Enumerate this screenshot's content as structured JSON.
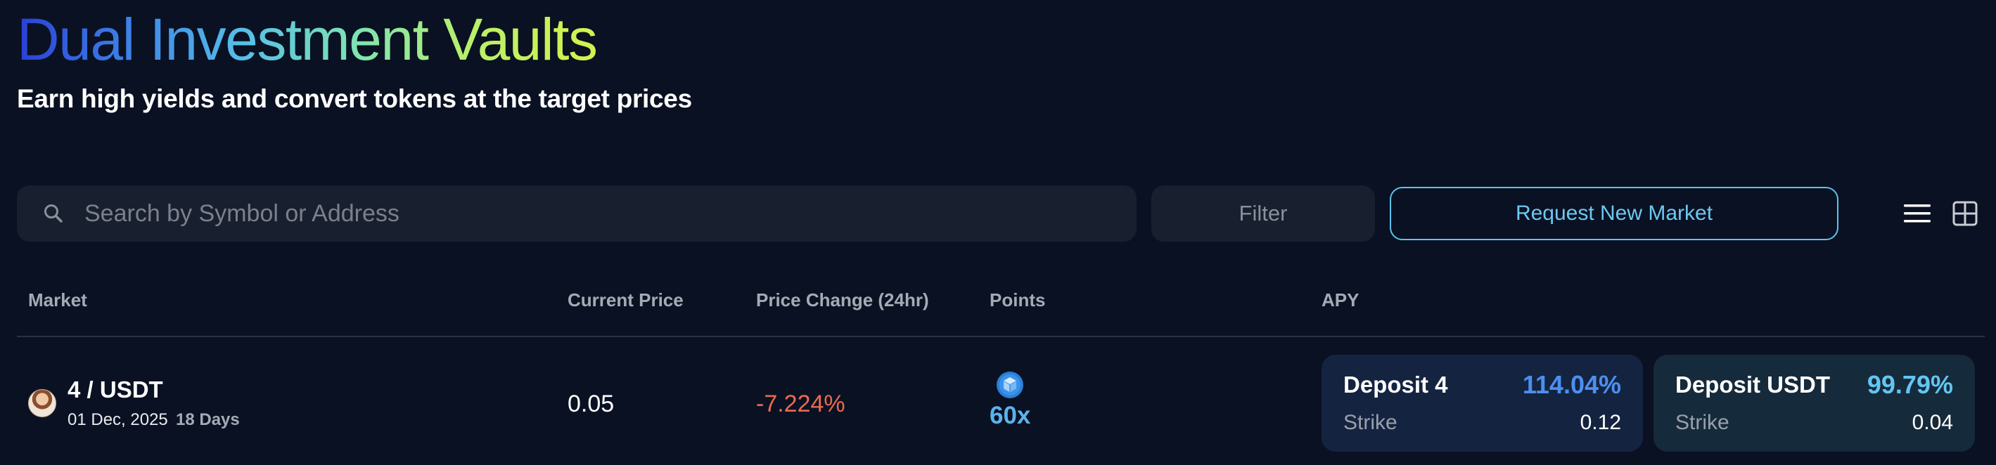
{
  "header": {
    "title": "Dual Investment Vaults",
    "subtitle": "Earn high yields and convert tokens at the target prices"
  },
  "toolbar": {
    "search_placeholder": "Search by Symbol or Address",
    "search_value": "",
    "filter_label": "Filter",
    "request_label": "Request New Market",
    "view_list_icon": "list-view-icon",
    "view_grid_icon": "grid-view-icon"
  },
  "table": {
    "columns": [
      "Market",
      "Current Price",
      "Price Change (24hr)",
      "Points",
      "APY"
    ],
    "rows": [
      {
        "pair": "4 / USDT",
        "date": "01 Dec, 2025",
        "days": "18 Days",
        "current_price": "0.05",
        "price_change": "-7.224%",
        "points_icon": "cube-icon",
        "points": "60x",
        "apy": [
          {
            "label": "Deposit 4",
            "apy": "114.04%",
            "strike_label": "Strike",
            "strike": "0.12"
          },
          {
            "label": "Deposit USDT",
            "apy": "99.79%",
            "strike_label": "Strike",
            "strike": "0.04"
          }
        ]
      }
    ]
  },
  "colors": {
    "background": "#0a1122",
    "accent": "#5cc3ee",
    "negative": "#ea6a4f",
    "apy_primary": "#4d8ff0",
    "apy_secondary": "#63c5f2"
  }
}
